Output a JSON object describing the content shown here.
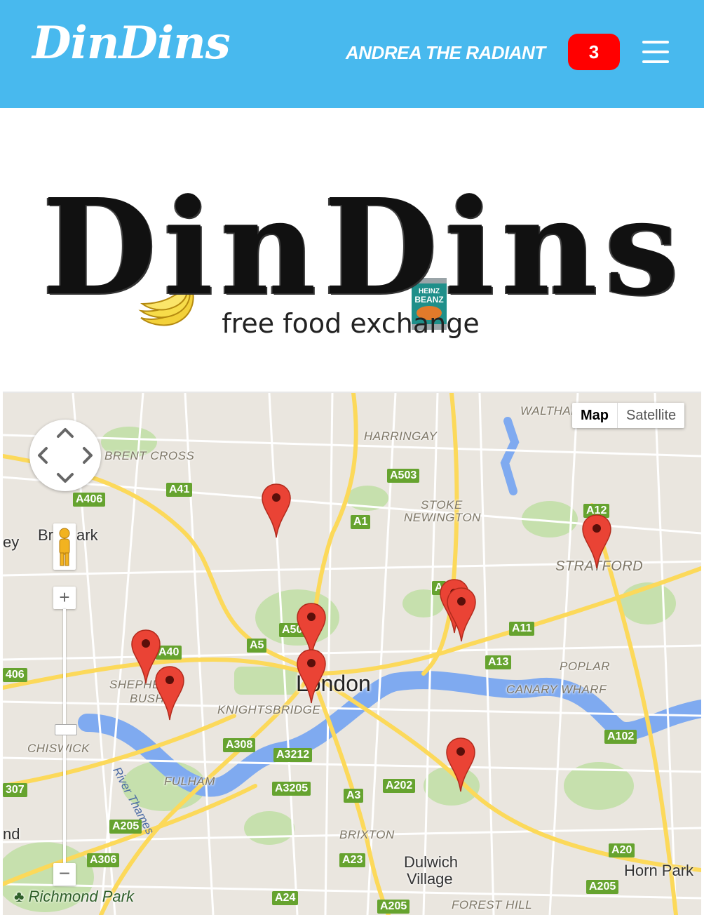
{
  "header": {
    "brand": "DinDins",
    "username": "ANDREA THE RADIANT",
    "notification_count": "3",
    "menu_icon": "hamburger-menu-icon"
  },
  "hero": {
    "logo_text": "DinDins",
    "tagline": "free food exchange",
    "can_label_1": "HEINZ",
    "can_label_2": "BEANZ"
  },
  "map": {
    "type_controls": {
      "map": "Map",
      "satellite": "Satellite"
    },
    "areas": {
      "brent_cross": "BRENT CROSS",
      "harringay": "HARRINGAY",
      "walthamstow": "WALTHAI",
      "stoke_1": "STOKE",
      "stoke_2": "NEWINGTON",
      "stratford": "STRATFORD",
      "shepherds_1": "SHEPHE",
      "shepherds_2": "BUSH",
      "knightsbridge": "KNIGHTSBRIDGE",
      "poplar": "POPLAR",
      "canary": "CANARY WHARF",
      "chiswick": "CHISWICK",
      "fulham": "FULHAM",
      "brixton": "BRIXTON",
      "forest_hill": "FOREST HILL"
    },
    "places": {
      "london": "London",
      "brent_park": "Br    t Park",
      "ey": "ey",
      "nd": "nd",
      "dulwich_1": "Dulwich",
      "dulwich_2": "Village",
      "horn_park": "Horn Park",
      "richmond": "Richmond Park"
    },
    "river": "River Thames",
    "roads": {
      "a406": "A406",
      "a41": "A41",
      "a503": "A503",
      "a1": "A1",
      "a12": "A12",
      "a10": "A",
      "a501": "A50",
      "a5": "A5",
      "a40": "A40",
      "a11": "A11",
      "a13": "A13",
      "a406w": "406",
      "a308": "A308",
      "a3212": "A3212",
      "a102": "A102",
      "a307": "307",
      "a3205": "A3205",
      "a3": "A3",
      "a202": "A202",
      "a205": "A205",
      "a306": "A306",
      "a23": "A23",
      "a20": "A20",
      "a205e": "A205",
      "a24": "A24",
      "a205s": "A205"
    },
    "marker_count": 9
  },
  "colors": {
    "header_bg": "#48b9ee",
    "badge_bg": "#ff0000",
    "marker": "#ea4335",
    "map_bg": "#eae6df",
    "water": "#7faaf0",
    "park": "#c6e0ad",
    "road_major": "#fcd95a"
  }
}
